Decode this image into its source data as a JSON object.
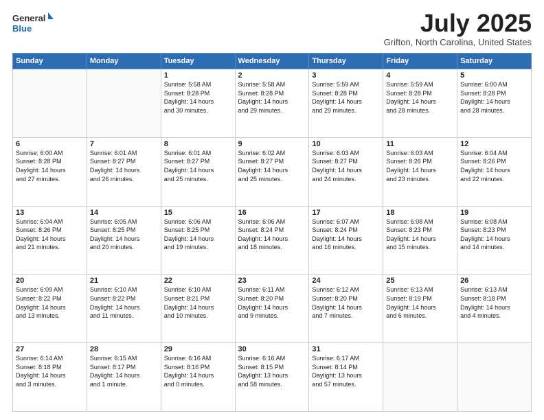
{
  "header": {
    "logo_line1": "General",
    "logo_line2": "Blue",
    "month_title": "July 2025",
    "location": "Grifton, North Carolina, United States"
  },
  "weekdays": [
    "Sunday",
    "Monday",
    "Tuesday",
    "Wednesday",
    "Thursday",
    "Friday",
    "Saturday"
  ],
  "weeks": [
    [
      {
        "day": "",
        "info": ""
      },
      {
        "day": "",
        "info": ""
      },
      {
        "day": "1",
        "info": "Sunrise: 5:58 AM\nSunset: 8:28 PM\nDaylight: 14 hours\nand 30 minutes."
      },
      {
        "day": "2",
        "info": "Sunrise: 5:58 AM\nSunset: 8:28 PM\nDaylight: 14 hours\nand 29 minutes."
      },
      {
        "day": "3",
        "info": "Sunrise: 5:59 AM\nSunset: 8:28 PM\nDaylight: 14 hours\nand 29 minutes."
      },
      {
        "day": "4",
        "info": "Sunrise: 5:59 AM\nSunset: 8:28 PM\nDaylight: 14 hours\nand 28 minutes."
      },
      {
        "day": "5",
        "info": "Sunrise: 6:00 AM\nSunset: 8:28 PM\nDaylight: 14 hours\nand 28 minutes."
      }
    ],
    [
      {
        "day": "6",
        "info": "Sunrise: 6:00 AM\nSunset: 8:28 PM\nDaylight: 14 hours\nand 27 minutes."
      },
      {
        "day": "7",
        "info": "Sunrise: 6:01 AM\nSunset: 8:27 PM\nDaylight: 14 hours\nand 26 minutes."
      },
      {
        "day": "8",
        "info": "Sunrise: 6:01 AM\nSunset: 8:27 PM\nDaylight: 14 hours\nand 25 minutes."
      },
      {
        "day": "9",
        "info": "Sunrise: 6:02 AM\nSunset: 8:27 PM\nDaylight: 14 hours\nand 25 minutes."
      },
      {
        "day": "10",
        "info": "Sunrise: 6:03 AM\nSunset: 8:27 PM\nDaylight: 14 hours\nand 24 minutes."
      },
      {
        "day": "11",
        "info": "Sunrise: 6:03 AM\nSunset: 8:26 PM\nDaylight: 14 hours\nand 23 minutes."
      },
      {
        "day": "12",
        "info": "Sunrise: 6:04 AM\nSunset: 8:26 PM\nDaylight: 14 hours\nand 22 minutes."
      }
    ],
    [
      {
        "day": "13",
        "info": "Sunrise: 6:04 AM\nSunset: 8:26 PM\nDaylight: 14 hours\nand 21 minutes."
      },
      {
        "day": "14",
        "info": "Sunrise: 6:05 AM\nSunset: 8:25 PM\nDaylight: 14 hours\nand 20 minutes."
      },
      {
        "day": "15",
        "info": "Sunrise: 6:06 AM\nSunset: 8:25 PM\nDaylight: 14 hours\nand 19 minutes."
      },
      {
        "day": "16",
        "info": "Sunrise: 6:06 AM\nSunset: 8:24 PM\nDaylight: 14 hours\nand 18 minutes."
      },
      {
        "day": "17",
        "info": "Sunrise: 6:07 AM\nSunset: 8:24 PM\nDaylight: 14 hours\nand 16 minutes."
      },
      {
        "day": "18",
        "info": "Sunrise: 6:08 AM\nSunset: 8:23 PM\nDaylight: 14 hours\nand 15 minutes."
      },
      {
        "day": "19",
        "info": "Sunrise: 6:08 AM\nSunset: 8:23 PM\nDaylight: 14 hours\nand 14 minutes."
      }
    ],
    [
      {
        "day": "20",
        "info": "Sunrise: 6:09 AM\nSunset: 8:22 PM\nDaylight: 14 hours\nand 13 minutes."
      },
      {
        "day": "21",
        "info": "Sunrise: 6:10 AM\nSunset: 8:22 PM\nDaylight: 14 hours\nand 11 minutes."
      },
      {
        "day": "22",
        "info": "Sunrise: 6:10 AM\nSunset: 8:21 PM\nDaylight: 14 hours\nand 10 minutes."
      },
      {
        "day": "23",
        "info": "Sunrise: 6:11 AM\nSunset: 8:20 PM\nDaylight: 14 hours\nand 9 minutes."
      },
      {
        "day": "24",
        "info": "Sunrise: 6:12 AM\nSunset: 8:20 PM\nDaylight: 14 hours\nand 7 minutes."
      },
      {
        "day": "25",
        "info": "Sunrise: 6:13 AM\nSunset: 8:19 PM\nDaylight: 14 hours\nand 6 minutes."
      },
      {
        "day": "26",
        "info": "Sunrise: 6:13 AM\nSunset: 8:18 PM\nDaylight: 14 hours\nand 4 minutes."
      }
    ],
    [
      {
        "day": "27",
        "info": "Sunrise: 6:14 AM\nSunset: 8:18 PM\nDaylight: 14 hours\nand 3 minutes."
      },
      {
        "day": "28",
        "info": "Sunrise: 6:15 AM\nSunset: 8:17 PM\nDaylight: 14 hours\nand 1 minute."
      },
      {
        "day": "29",
        "info": "Sunrise: 6:16 AM\nSunset: 8:16 PM\nDaylight: 14 hours\nand 0 minutes."
      },
      {
        "day": "30",
        "info": "Sunrise: 6:16 AM\nSunset: 8:15 PM\nDaylight: 13 hours\nand 58 minutes."
      },
      {
        "day": "31",
        "info": "Sunrise: 6:17 AM\nSunset: 8:14 PM\nDaylight: 13 hours\nand 57 minutes."
      },
      {
        "day": "",
        "info": ""
      },
      {
        "day": "",
        "info": ""
      }
    ]
  ]
}
